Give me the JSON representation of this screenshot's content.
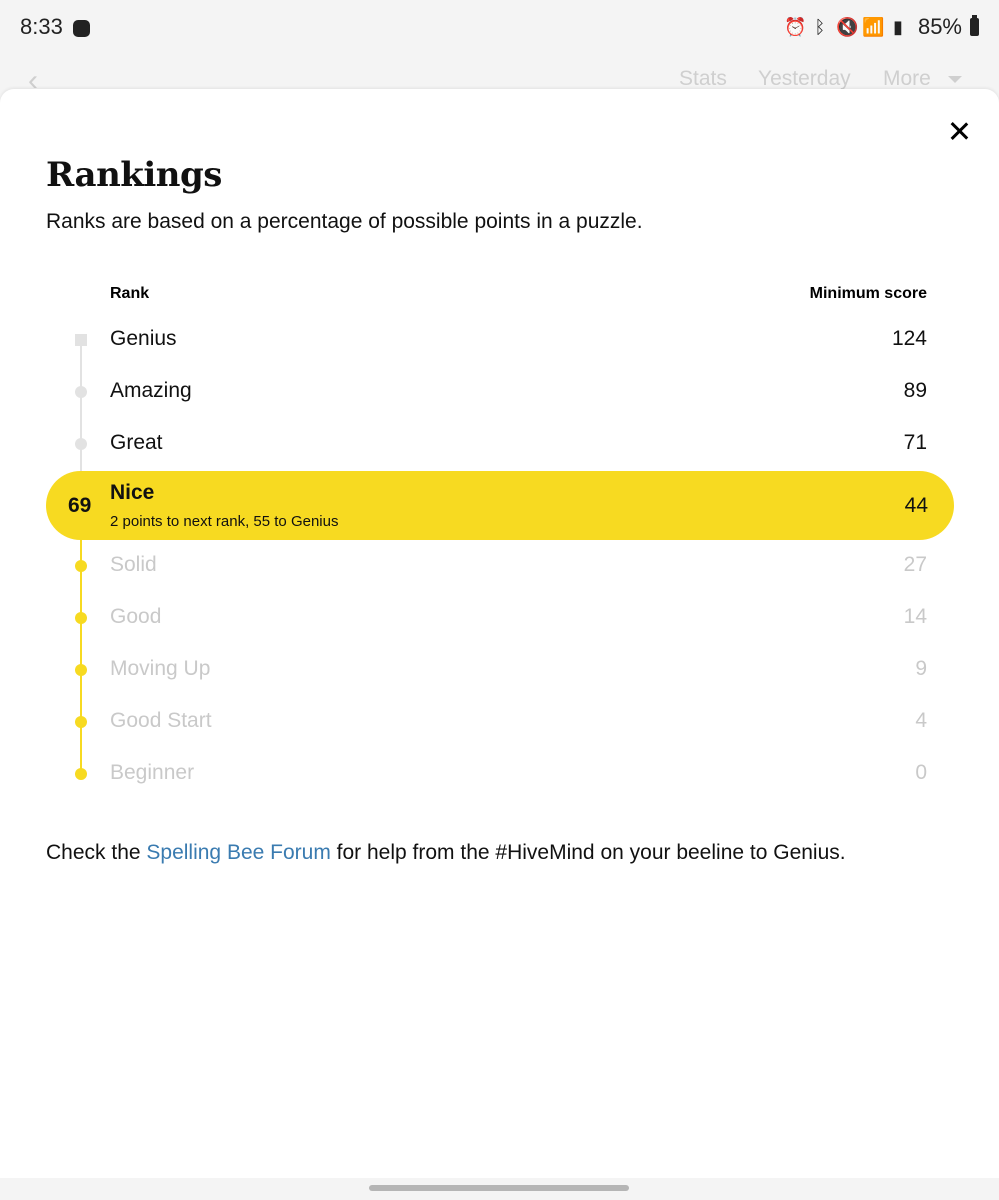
{
  "status_bar": {
    "time": "8:33",
    "battery_percent": "85%"
  },
  "header": {
    "stats": "Stats",
    "yesterday": "Yesterday",
    "more": "More"
  },
  "modal": {
    "title": "Rankings",
    "subtitle": "Ranks are based on a percentage of possible points in a puzzle.",
    "columns": {
      "rank": "Rank",
      "minimum_score": "Minimum score"
    },
    "ranks": [
      {
        "name": "Genius",
        "min": "124"
      },
      {
        "name": "Amazing",
        "min": "89"
      },
      {
        "name": "Great",
        "min": "71"
      },
      {
        "name": "Nice",
        "min": "44"
      },
      {
        "name": "Solid",
        "min": "27"
      },
      {
        "name": "Good",
        "min": "14"
      },
      {
        "name": "Moving Up",
        "min": "9"
      },
      {
        "name": "Good Start",
        "min": "4"
      },
      {
        "name": "Beginner",
        "min": "0"
      }
    ],
    "current": {
      "score": "69",
      "name": "Nice",
      "progress": "2 points to next rank, 55 to Genius",
      "min": "44"
    },
    "footer": {
      "before": "Check the ",
      "link": "Spelling Bee Forum",
      "after": " for help from the #HiveMind on your beeline to Genius."
    }
  },
  "colors": {
    "accent_yellow": "#f7da21",
    "link_blue": "#3a7bb0",
    "muted_gray": "#c9c9c9"
  },
  "icons": [
    "back-icon",
    "close-icon",
    "chevron-down-icon"
  ]
}
